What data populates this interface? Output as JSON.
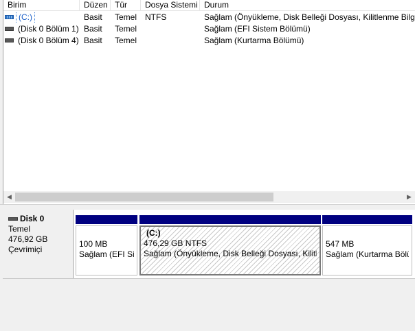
{
  "columns": [
    "Birim",
    "Düzen",
    "Tür",
    "Dosya Sistemi",
    "Durum"
  ],
  "volumes": [
    {
      "icon": "system-volume-icon",
      "name": "(C:)",
      "layout": "Basit",
      "type": "Temel",
      "fs": "NTFS",
      "status": "Sağlam (Önyükleme, Disk Belleği Dosyası, Kilitlenme Bilgisi"
    },
    {
      "icon": "volume-icon",
      "name": "(Disk 0 Bölüm 1)",
      "layout": "Basit",
      "type": "Temel",
      "fs": "",
      "status": "Sağlam (EFI Sistem Bölümü)"
    },
    {
      "icon": "volume-icon",
      "name": "(Disk 0 Bölüm 4)",
      "layout": "Basit",
      "type": "Temel",
      "fs": "",
      "status": "Sağlam (Kurtarma Bölümü)"
    }
  ],
  "scrollbar": {
    "left_arrow": "◀",
    "right_arrow": "▶"
  },
  "disk": {
    "title": "Disk 0",
    "type": "Temel",
    "size": "476,92 GB",
    "state": "Çevrimiçi",
    "partitions": [
      {
        "label": "",
        "size": "100 MB",
        "status": "Sağlam (EFI Sistem Bölümü)"
      },
      {
        "label": "(C:)",
        "size": "476,29 GB NTFS",
        "status": "Sağlam (Önyükleme, Disk Belleği Dosyası, Kilitlenme Bilgisi)"
      },
      {
        "label": "",
        "size": "547 MB",
        "status": "Sağlam (Kurtarma Bölümü)"
      }
    ]
  },
  "colors": {
    "partition_bar": "#000080",
    "selection_outline": "#3c7fd6"
  }
}
